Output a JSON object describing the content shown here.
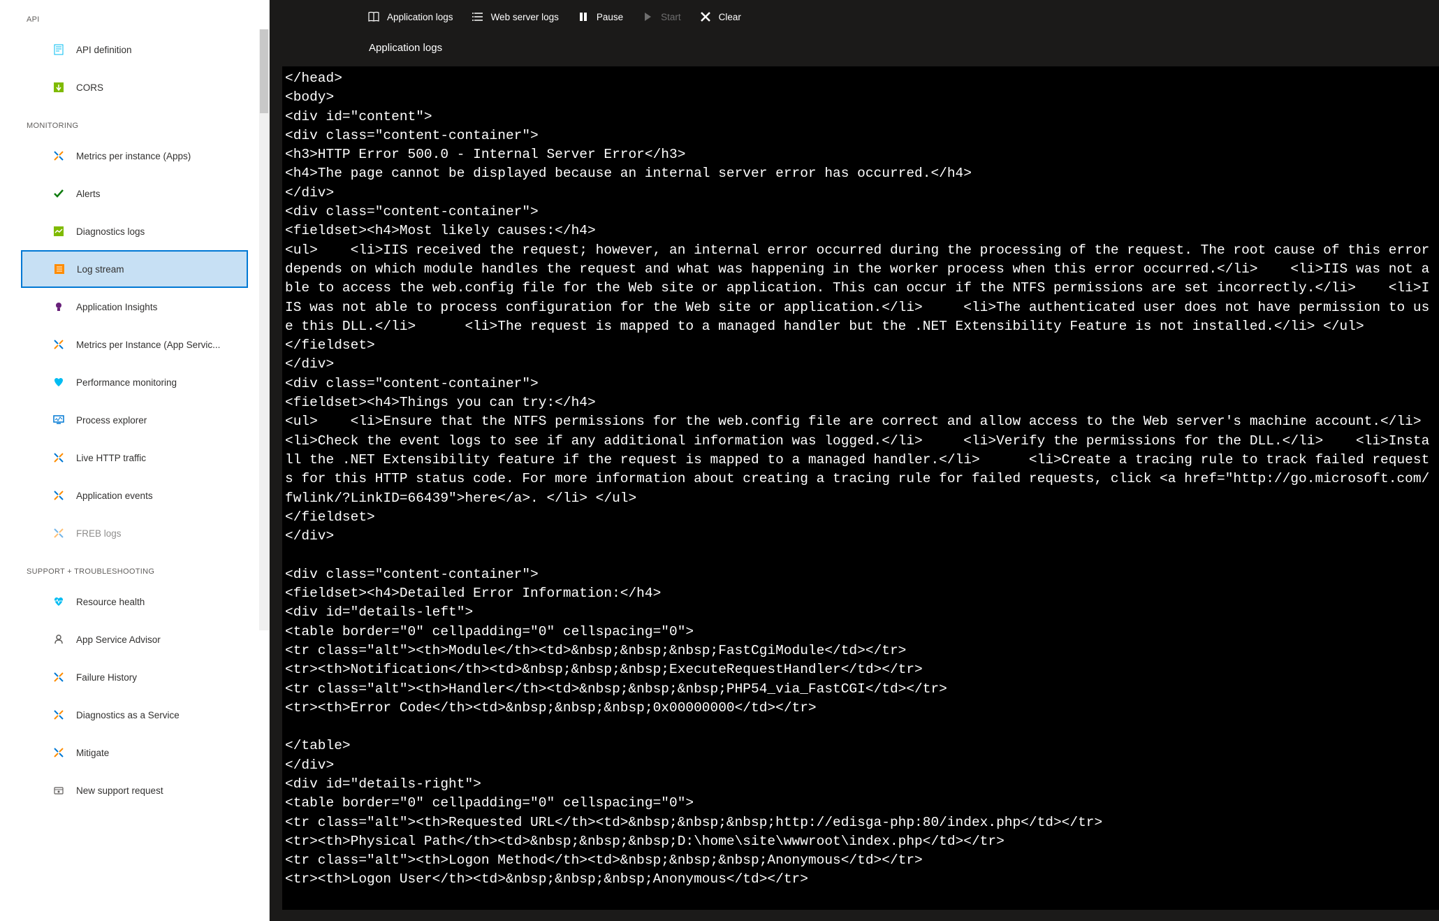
{
  "toolbar": {
    "app_logs": "Application logs",
    "web_logs": "Web server logs",
    "pause": "Pause",
    "start": "Start",
    "clear": "Clear"
  },
  "page_title": "Application logs",
  "sections": {
    "api": "API",
    "monitoring": "MONITORING",
    "support": "SUPPORT + TROUBLESHOOTING"
  },
  "nav": {
    "api_definition": "API definition",
    "cors": "CORS",
    "metrics_apps": "Metrics per instance (Apps)",
    "alerts": "Alerts",
    "diagnostics_logs": "Diagnostics logs",
    "log_stream": "Log stream",
    "application_insights": "Application Insights",
    "metrics_app_service": "Metrics per Instance (App Servic...",
    "performance_monitoring": "Performance monitoring",
    "process_explorer": "Process explorer",
    "live_http": "Live HTTP traffic",
    "application_events": "Application events",
    "freb_logs": "FREB logs",
    "resource_health": "Resource health",
    "app_service_advisor": "App Service Advisor",
    "failure_history": "Failure History",
    "diagnostics_service": "Diagnostics as a Service",
    "mitigate": "Mitigate",
    "new_support": "New support request"
  },
  "log_lines": [
    "</head>",
    "<body>",
    "<div id=\"content\">",
    "<div class=\"content-container\">",
    "<h3>HTTP Error 500.0 - Internal Server Error</h3>",
    "<h4>The page cannot be displayed because an internal server error has occurred.</h4>",
    "</div>",
    "<div class=\"content-container\">",
    "<fieldset><h4>Most likely causes:</h4>",
    "<ul>    <li>IIS received the request; however, an internal error occurred during the processing of the request. The root cause of this error depends on which module handles the request and what was happening in the worker process when this error occurred.</li>    <li>IIS was not able to access the web.config file for the Web site or application. This can occur if the NTFS permissions are set incorrectly.</li>    <li>IIS was not able to process configuration for the Web site or application.</li>     <li>The authenticated user does not have permission to use this DLL.</li>      <li>The request is mapped to a managed handler but the .NET Extensibility Feature is not installed.</li> </ul>",
    "</fieldset>",
    "</div>",
    "<div class=\"content-container\">",
    "<fieldset><h4>Things you can try:</h4>",
    "<ul>    <li>Ensure that the NTFS permissions for the web.config file are correct and allow access to the Web server's machine account.</li>    <li>Check the event logs to see if any additional information was logged.</li>     <li>Verify the permissions for the DLL.</li>    <li>Install the .NET Extensibility feature if the request is mapped to a managed handler.</li>      <li>Create a tracing rule to track failed requests for this HTTP status code. For more information about creating a tracing rule for failed requests, click <a href=\"http://go.microsoft.com/fwlink/?LinkID=66439\">here</a>. </li> </ul>",
    "</fieldset>",
    "</div>",
    "",
    "<div class=\"content-container\">",
    "<fieldset><h4>Detailed Error Information:</h4>",
    "<div id=\"details-left\">",
    "<table border=\"0\" cellpadding=\"0\" cellspacing=\"0\">",
    "<tr class=\"alt\"><th>Module</th><td>&nbsp;&nbsp;&nbsp;FastCgiModule</td></tr>",
    "<tr><th>Notification</th><td>&nbsp;&nbsp;&nbsp;ExecuteRequestHandler</td></tr>",
    "<tr class=\"alt\"><th>Handler</th><td>&nbsp;&nbsp;&nbsp;PHP54_via_FastCGI</td></tr>",
    "<tr><th>Error Code</th><td>&nbsp;&nbsp;&nbsp;0x00000000</td></tr>",
    "",
    "</table>",
    "</div>",
    "<div id=\"details-right\">",
    "<table border=\"0\" cellpadding=\"0\" cellspacing=\"0\">",
    "<tr class=\"alt\"><th>Requested URL</th><td>&nbsp;&nbsp;&nbsp;http://edisga-php:80/index.php</td></tr>",
    "<tr><th>Physical Path</th><td>&nbsp;&nbsp;&nbsp;D:\\home\\site\\wwwroot\\index.php</td></tr>",
    "<tr class=\"alt\"><th>Logon Method</th><td>&nbsp;&nbsp;&nbsp;Anonymous</td></tr>",
    "<tr><th>Logon User</th><td>&nbsp;&nbsp;&nbsp;Anonymous</td></tr>",
    ""
  ]
}
